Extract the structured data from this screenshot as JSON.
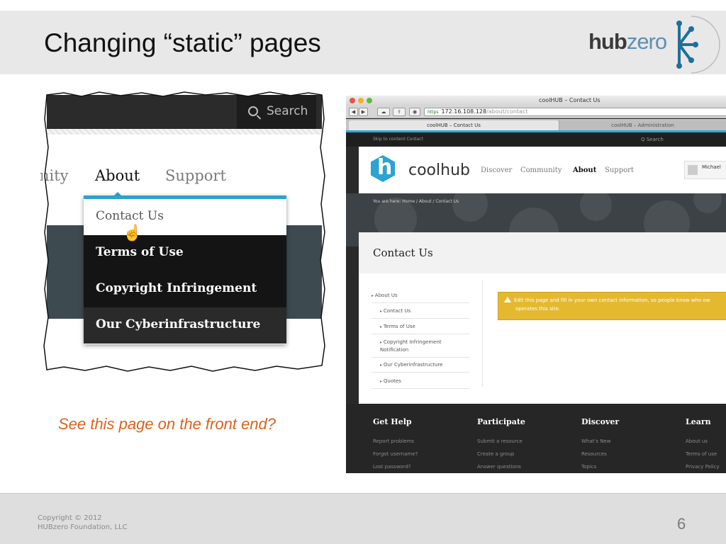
{
  "slide": {
    "title": "Changing “static” pages",
    "logo": {
      "hub": "hub",
      "zero": "zero"
    },
    "caption": "See this page on the front end?",
    "copyright_line1": "Copyright © 2012",
    "copyright_line2": "HUBzero Foundation, LLC",
    "page_number": "6"
  },
  "colors": {
    "accent": "#29a3cf",
    "caption": "#e0601c",
    "warning": "#e4b930",
    "logo_blue": "#5f8fb0"
  },
  "left_screenshot": {
    "search_label": "Search",
    "nav": {
      "partial": "nity",
      "about": "About",
      "support": "Support"
    },
    "menu": [
      "Contact Us",
      "Terms of Use",
      "Copyright Infringement",
      "Our Cyberinfrastructure"
    ]
  },
  "browser": {
    "window_title": "coolHUB – Contact Us",
    "url_scheme": "https",
    "url_host": "172.16.108.128",
    "url_path": "/about/contact",
    "tabs": [
      "coolHUB – Contact Us",
      "coolHUB – Administration"
    ],
    "skip_links": "Skip to content   Contact",
    "search_placeholder": "Q  Search",
    "site_name": "coolhub",
    "site_logo_letter": "h",
    "nav": [
      "Discover",
      "Community",
      "About",
      "Support"
    ],
    "user_name": "Michael",
    "breadcrumb": "You are here: Home / About / Contact Us",
    "page_title": "Contact Us",
    "sidebar": [
      "About Us",
      "Contact Us",
      "Terms of Use",
      "Copyright Infringement Notification",
      "Our Cyberinfrastructure",
      "Quotes"
    ],
    "warning_text_1": "Edit this page and fill in your own contact information, so people know who ow",
    "warning_text_2": "operates this site.",
    "footer": [
      {
        "heading": "Get Help",
        "links": [
          "Report problems",
          "Forgot username?",
          "Lost password?"
        ]
      },
      {
        "heading": "Participate",
        "links": [
          "Submit a resource",
          "Create a group",
          "Answer questions"
        ]
      },
      {
        "heading": "Discover",
        "links": [
          "What's New",
          "Resources",
          "Topics"
        ]
      },
      {
        "heading": "Learn",
        "links": [
          "About us",
          "Terms of use",
          "Privacy Policy"
        ]
      }
    ]
  }
}
